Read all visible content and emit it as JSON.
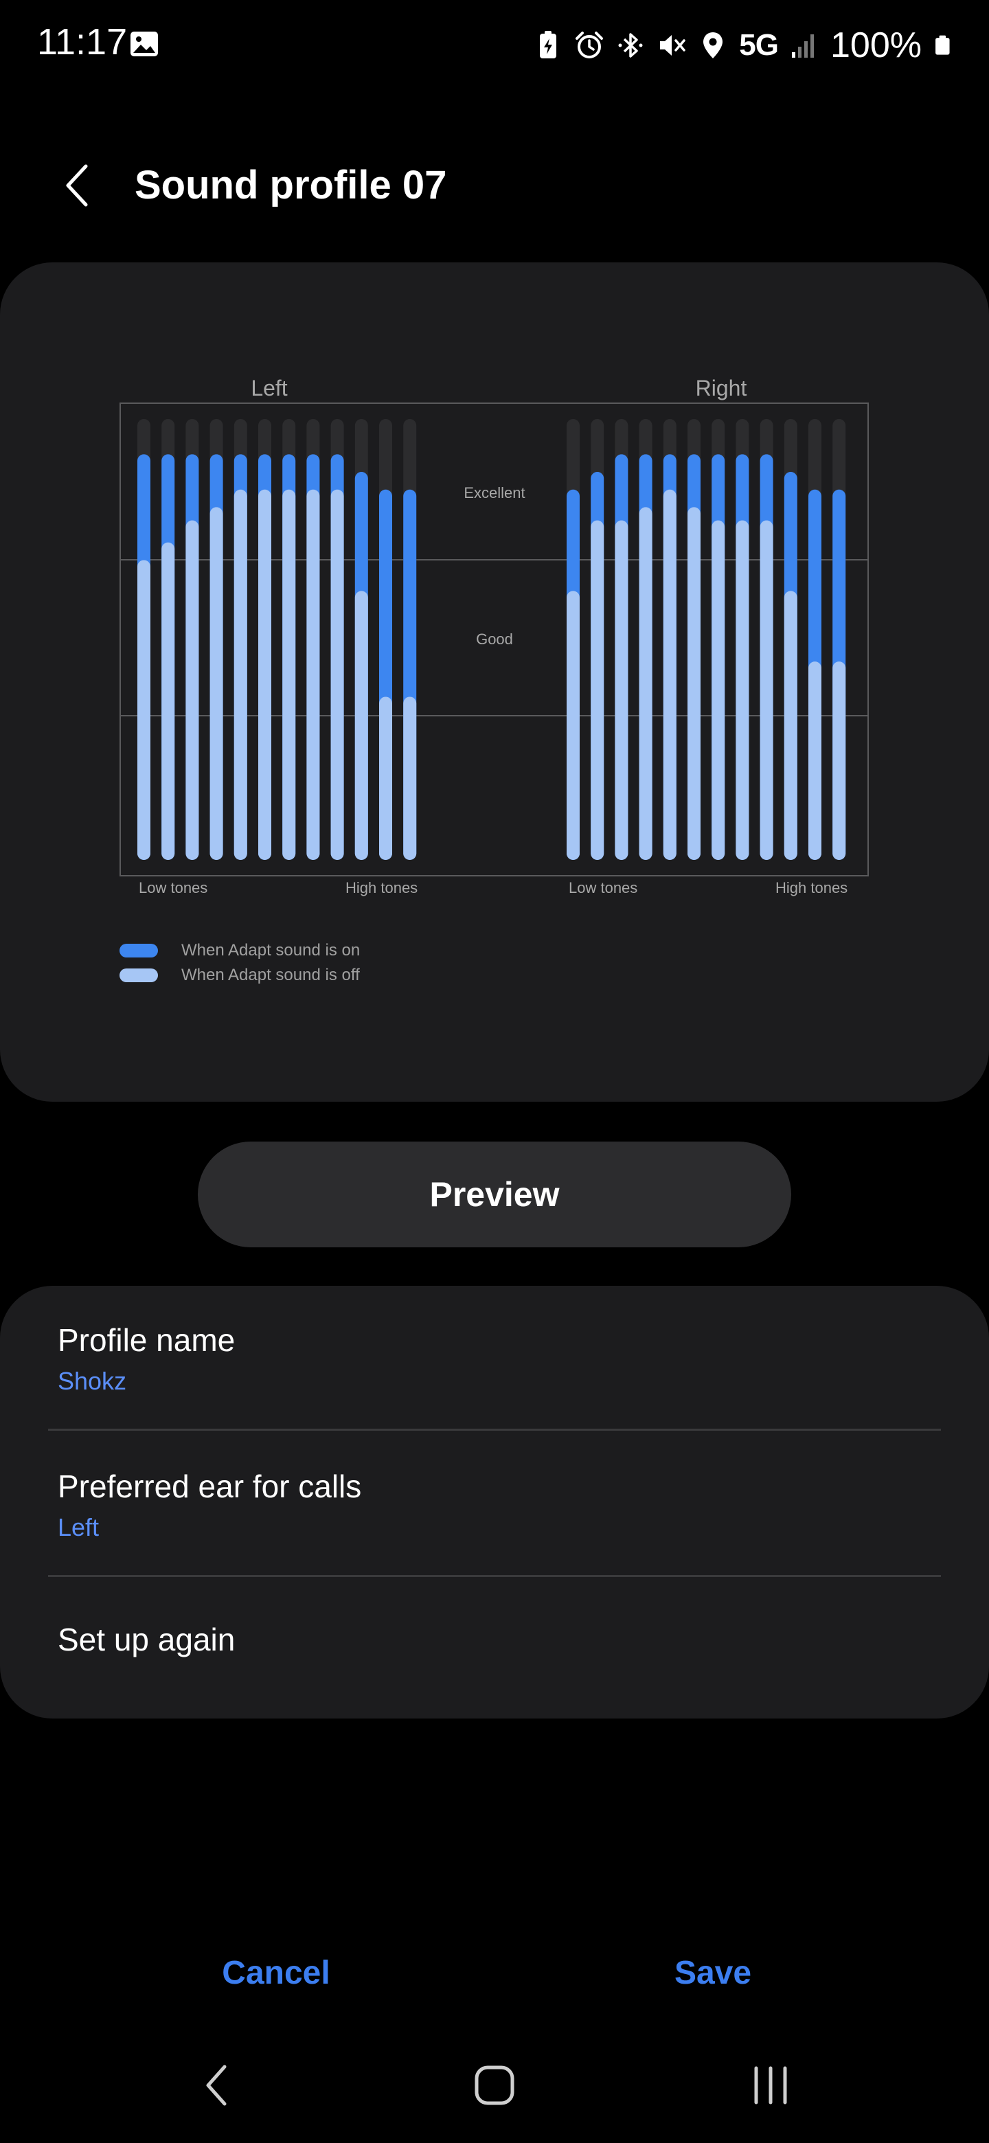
{
  "status_bar": {
    "time": "11:17",
    "network": "5G",
    "battery": "100%",
    "icons": [
      "gallery-icon",
      "battery-saver-icon",
      "alarm-icon",
      "bluetooth-icon",
      "mute-icon",
      "location-icon",
      "signal-icon",
      "battery-icon"
    ]
  },
  "header": {
    "title": "Sound profile 07",
    "back_icon": "chevron-left-icon"
  },
  "chart_data": [
    {
      "type": "bar",
      "title": "Left",
      "categories": [
        "1",
        "2",
        "3",
        "4",
        "5",
        "6",
        "7",
        "8",
        "9",
        "10",
        "11",
        "12"
      ],
      "x_axis_labels": {
        "start": "Low tones",
        "end": "High tones"
      },
      "y_bands": [
        "Excellent",
        "Good"
      ],
      "ylim": [
        0,
        100
      ],
      "series": [
        {
          "name": "When Adapt sound is on",
          "values": [
            92,
            92,
            92,
            92,
            92,
            92,
            92,
            92,
            92,
            88,
            84,
            84
          ]
        },
        {
          "name": "When Adapt sound is off",
          "values": [
            68,
            72,
            77,
            80,
            84,
            84,
            84,
            84,
            84,
            61,
            37,
            37
          ]
        }
      ]
    },
    {
      "type": "bar",
      "title": "Right",
      "categories": [
        "1",
        "2",
        "3",
        "4",
        "5",
        "6",
        "7",
        "8",
        "9",
        "10",
        "11",
        "12"
      ],
      "x_axis_labels": {
        "start": "Low tones",
        "end": "High tones"
      },
      "y_bands": [
        "Excellent",
        "Good"
      ],
      "ylim": [
        0,
        100
      ],
      "series": [
        {
          "name": "When Adapt sound is on",
          "values": [
            84,
            88,
            92,
            92,
            92,
            92,
            92,
            92,
            92,
            88,
            84,
            84
          ]
        },
        {
          "name": "When Adapt sound is off",
          "values": [
            61,
            77,
            77,
            80,
            84,
            80,
            77,
            77,
            77,
            61,
            45,
            45
          ]
        }
      ]
    }
  ],
  "legend": {
    "items": [
      {
        "label": "When Adapt sound is on",
        "color": "#3d86f0"
      },
      {
        "label": "When Adapt sound is off",
        "color": "#a6c6f5"
      }
    ]
  },
  "colors": {
    "on": "#3d86f0",
    "off": "#a6c6f5",
    "track": "#2c2c2e",
    "accent": "#3c7ef0",
    "value_text": "#5b8ff9"
  },
  "preview": {
    "label": "Preview"
  },
  "settings": {
    "profile_name": {
      "title": "Profile name",
      "value": "Shokz"
    },
    "preferred_ear": {
      "title": "Preferred ear for calls",
      "value": "Left"
    },
    "setup_again": {
      "title": "Set up again"
    }
  },
  "actions": {
    "cancel": "Cancel",
    "save": "Save"
  },
  "nav": {
    "icons": [
      "back-icon",
      "home-icon",
      "recents-icon"
    ]
  }
}
